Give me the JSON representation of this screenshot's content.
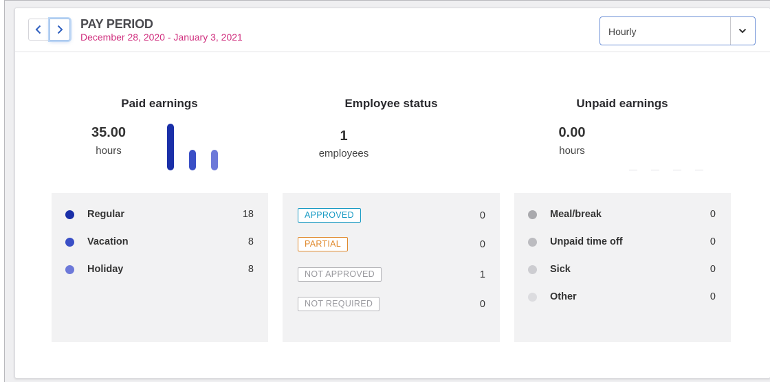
{
  "header": {
    "title": "PAY PERIOD",
    "dates": "December 28, 2020 - January 3, 2021",
    "prev_icon": "chevron-left-icon",
    "next_icon": "chevron-right-icon",
    "select": {
      "value": "Hourly",
      "icon": "chevron-down-icon"
    }
  },
  "paid": {
    "title": "Paid earnings",
    "total": "35.00",
    "unit": "hours",
    "items": [
      {
        "label": "Regular",
        "value": "18",
        "color": "#1a2fa8"
      },
      {
        "label": "Vacation",
        "value": "8",
        "color": "#3a4fc6"
      },
      {
        "label": "Holiday",
        "value": "8",
        "color": "#6d79d9"
      }
    ]
  },
  "status": {
    "title": "Employee status",
    "total": "1",
    "unit": "employees",
    "items": [
      {
        "label": "APPROVED",
        "value": "0",
        "color": "#1a9bc4"
      },
      {
        "label": "PARTIAL",
        "value": "0",
        "color": "#e08a2e"
      },
      {
        "label": "NOT APPROVED",
        "value": "1",
        "color": "#9a9a9f"
      },
      {
        "label": "NOT REQUIRED",
        "value": "0",
        "color": "#9a9a9f"
      }
    ]
  },
  "unpaid": {
    "title": "Unpaid earnings",
    "total": "0.00",
    "unit": "hours",
    "items": [
      {
        "label": "Meal/break",
        "value": "0",
        "color": "#a9a9ad"
      },
      {
        "label": "Unpaid time off",
        "value": "0",
        "color": "#bcbcc0"
      },
      {
        "label": "Sick",
        "value": "0",
        "color": "#cdcdd1"
      },
      {
        "label": "Other",
        "value": "0",
        "color": "#dcdcdf"
      }
    ]
  }
}
